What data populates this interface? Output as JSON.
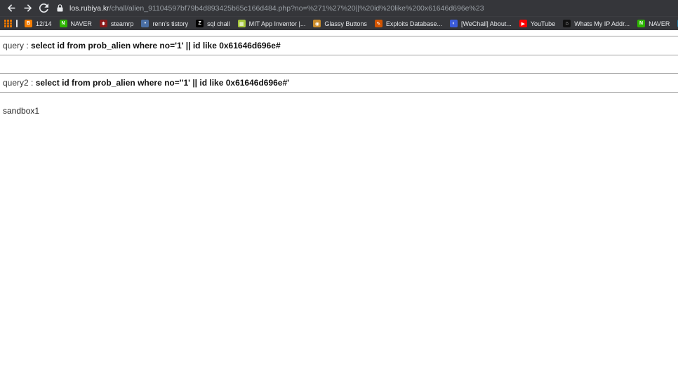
{
  "browser": {
    "url_host": "los.rubiya.kr",
    "url_path": "/chall/alien_91104597bf79b4d893425b65c166d484.php?no=%271%27%20||%20id%20like%200x61646d696e%23"
  },
  "bookmarks": [
    {
      "label": "12/14",
      "icon": "blogger-icon",
      "color": "#f57d00",
      "glyph": "B"
    },
    {
      "label": "NAVER",
      "icon": "naver-icon",
      "color": "#2db400",
      "glyph": "N"
    },
    {
      "label": "steamrp",
      "icon": "steamrp-icon",
      "color": "#8b1a1a",
      "glyph": "✱"
    },
    {
      "label": "renn's tistory",
      "icon": "tistory-icon",
      "color": "#4a6fa5",
      "glyph": "•"
    },
    {
      "label": "sql chall",
      "icon": "z-icon",
      "color": "#000000",
      "glyph": "Z"
    },
    {
      "label": "MIT App Inventor |...",
      "icon": "app-inventor-icon",
      "color": "#a5c639",
      "glyph": "▦"
    },
    {
      "label": "Glassy Buttons",
      "icon": "glassy-buttons-icon",
      "color": "#c98b2b",
      "glyph": "◉"
    },
    {
      "label": "Exploits Database...",
      "icon": "exploit-db-icon",
      "color": "#d35400",
      "glyph": "✎"
    },
    {
      "label": "[WeChall] About...",
      "icon": "wechall-icon",
      "color": "#3b5bdb",
      "glyph": "◐"
    },
    {
      "label": "YouTube",
      "icon": "youtube-icon",
      "color": "#ff0000",
      "glyph": "▶"
    },
    {
      "label": "Whats My IP Addr...",
      "icon": "ip-icon",
      "color": "#111111",
      "glyph": "⌂"
    },
    {
      "label": "NAVER",
      "icon": "naver-icon",
      "color": "#2db400",
      "glyph": "N"
    },
    {
      "label": "",
      "icon": "wordpress-icon",
      "color": "#21759b",
      "glyph": "W"
    }
  ],
  "page": {
    "query_label": "query : ",
    "query_sql": "select id from prob_alien where no='1' || id like 0x61646d696e#",
    "query2_label": "query2 : ",
    "query2_sql": "select id from prob_alien where no=''1' || id like 0x61646d696e#'",
    "result": "sandbox1"
  }
}
